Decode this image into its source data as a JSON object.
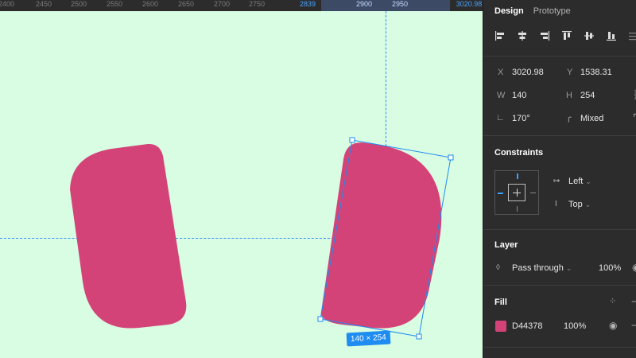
{
  "ruler": {
    "ticks": [
      "2400",
      "2450",
      "2500",
      "2550",
      "2600",
      "2650",
      "2700",
      "2750",
      "2839",
      "2900",
      "2950",
      "3020.98"
    ]
  },
  "selection": {
    "size_badge": "140 × 254"
  },
  "panel": {
    "tabs": {
      "design": "Design",
      "prototype": "Prototype"
    },
    "position": {
      "x_label": "X",
      "x_value": "3020.98",
      "y_label": "Y",
      "y_value": "1538.31",
      "w_label": "W",
      "w_value": "140",
      "h_label": "H",
      "h_value": "254",
      "rotation_value": "170°",
      "radius_value": "Mixed"
    },
    "constraints": {
      "title": "Constraints",
      "horizontal": "Left",
      "vertical": "Top"
    },
    "layer": {
      "title": "Layer",
      "blend_mode": "Pass through",
      "opacity": "100%"
    },
    "fill": {
      "title": "Fill",
      "hex": "D44378",
      "opacity": "100%"
    }
  },
  "colors": {
    "canvas_bg": "#d8fde3",
    "shape_fill": "#D44378",
    "selection": "#1e8cf0",
    "panel_bg": "#2c2c2c"
  }
}
